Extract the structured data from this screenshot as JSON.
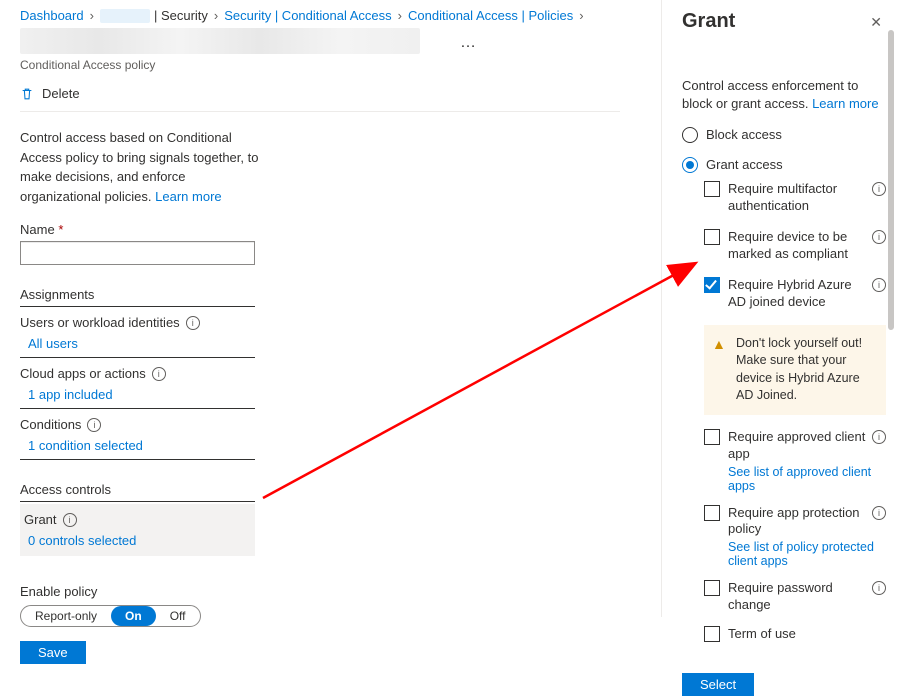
{
  "breadcrumb": {
    "items": [
      {
        "label": "Dashboard"
      },
      {
        "label": ""
      },
      {
        "label": "| Security"
      },
      {
        "label": "Security | Conditional Access"
      },
      {
        "label": "Conditional Access | Policies"
      }
    ],
    "more": "…"
  },
  "header": {
    "subtitle": "Conditional Access policy",
    "delete": "Delete"
  },
  "description": "Control access based on Conditional Access policy to bring signals together, to make decisions, and enforce organizational policies.",
  "learn_more": "Learn more",
  "name_field": {
    "label": "Name",
    "value": ""
  },
  "assignments": {
    "heading": "Assignments",
    "users": {
      "label": "Users or workload identities",
      "value": "All users"
    },
    "apps": {
      "label": "Cloud apps or actions",
      "value": "1 app included"
    },
    "cond": {
      "label": "Conditions",
      "value": "1 condition selected"
    }
  },
  "access_controls": {
    "heading": "Access controls",
    "grant": {
      "label": "Grant",
      "value": "0 controls selected"
    }
  },
  "enable_policy": {
    "heading": "Enable policy",
    "report": "Report-only",
    "on": "On",
    "off": "Off",
    "active": "On"
  },
  "save_label": "Save",
  "panel": {
    "title": "Grant",
    "desc_prefix": "Control access enforcement to block or grant access.",
    "learn_more": "Learn more",
    "block": "Block access",
    "grant": "Grant access",
    "selected_radio": "grant",
    "controls": [
      {
        "id": "mfa",
        "label": "Require multifactor authentication",
        "checked": false
      },
      {
        "id": "compl",
        "label": "Require device to be marked as compliant",
        "checked": false
      },
      {
        "id": "hybrid",
        "label": "Require Hybrid Azure AD joined device",
        "checked": true
      },
      {
        "id": "appr",
        "label": "Require approved client app",
        "checked": false,
        "sublink": "See list of approved client apps"
      },
      {
        "id": "prot",
        "label": "Require app protection policy",
        "checked": false,
        "sublink": "See list of policy protected client apps"
      },
      {
        "id": "pwd",
        "label": "Require password change",
        "checked": false
      },
      {
        "id": "tou",
        "label": "Term of use",
        "checked": false,
        "noinfo": true
      }
    ],
    "warning": "Don't lock yourself out! Make sure that your device is Hybrid Azure AD Joined.",
    "select_btn": "Select"
  }
}
